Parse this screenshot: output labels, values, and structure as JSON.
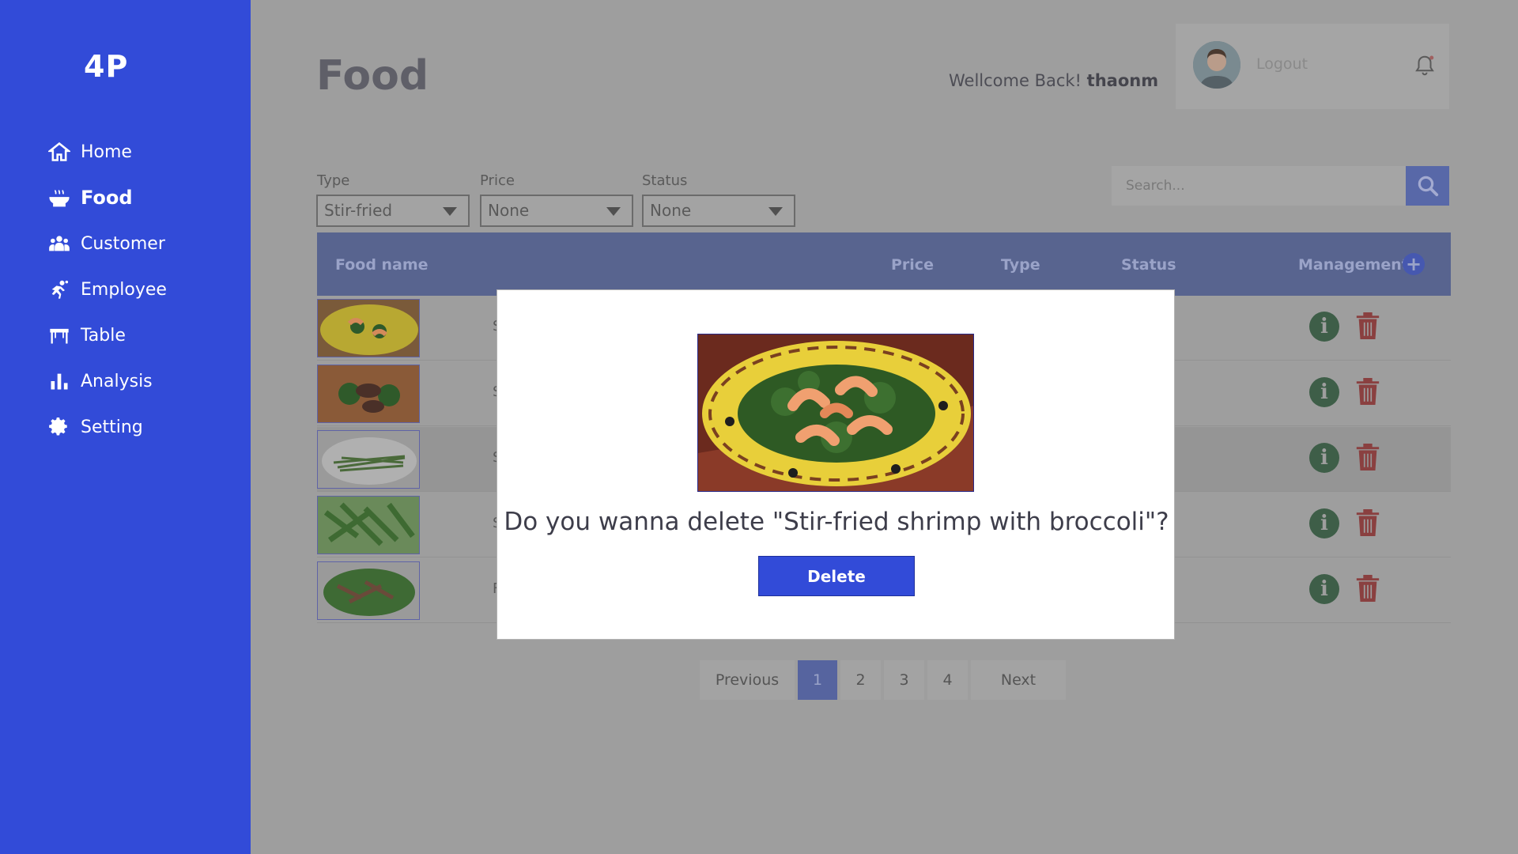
{
  "sidebar": {
    "logo": "4P",
    "items": [
      {
        "label": "Home",
        "icon": "home-icon"
      },
      {
        "label": "Food",
        "icon": "food-bowl-icon",
        "active": true
      },
      {
        "label": "Customer",
        "icon": "users-icon"
      },
      {
        "label": "Employee",
        "icon": "employee-icon"
      },
      {
        "label": "Table",
        "icon": "table-icon"
      },
      {
        "label": "Analysis",
        "icon": "bar-chart-icon"
      },
      {
        "label": "Setting",
        "icon": "gear-icon"
      }
    ],
    "color": "#324bd8"
  },
  "header": {
    "title": "Food",
    "welcome_prefix": "Wellcome Back!",
    "username": "thaonm",
    "logout_label": "Logout"
  },
  "filters": {
    "type": {
      "label": "Type",
      "value": "Stir-fried"
    },
    "price": {
      "label": "Price",
      "value": "None"
    },
    "status": {
      "label": "Status",
      "value": "None"
    }
  },
  "search": {
    "placeholder": "Search..."
  },
  "table": {
    "columns": {
      "food_name": "Food name",
      "price": "Price",
      "type": "Type",
      "status": "Status",
      "management": "Management"
    },
    "rows": [
      {
        "name_fragment": "S",
        "thumb": "shrimp-broccoli"
      },
      {
        "name_fragment": "S",
        "thumb": "beef-broccoli"
      },
      {
        "name_fragment": "S",
        "thumb": "green-beans"
      },
      {
        "name_fragment": "S",
        "thumb": "green-vegetables"
      },
      {
        "name_fragment": "F",
        "thumb": "mixed-stir-fry"
      }
    ]
  },
  "pagination": {
    "previous": "Previous",
    "pages": [
      "1",
      "2",
      "3",
      "4"
    ],
    "current": "1",
    "next": "Next"
  },
  "modal": {
    "question": "Do you wanna delete \"Stir-fried shrimp with broccoli\"?",
    "delete_label": "Delete"
  }
}
